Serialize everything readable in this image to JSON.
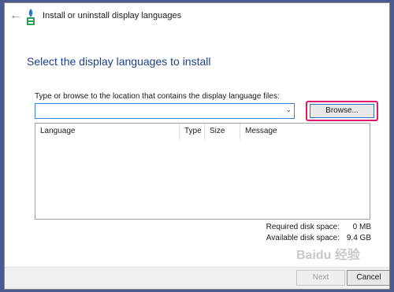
{
  "window": {
    "title": "Install or uninstall display languages",
    "back_icon": "arrow-left-icon",
    "app_icon": "language-icon"
  },
  "main": {
    "heading": "Select the display languages to install",
    "instruction": "Type or browse to the location that contains the display language files:",
    "path_value": "",
    "browse_label": "Browse...",
    "table": {
      "columns": [
        "Language",
        "Type",
        "Size",
        "Message"
      ],
      "rows": []
    },
    "disk": {
      "required_label": "Required disk space:",
      "required_value": "0 MB",
      "available_label": "Available disk space:",
      "available_value": "9.4 GB"
    }
  },
  "footer": {
    "next_label": "Next",
    "cancel_label": "Cancel"
  },
  "watermark": "Baidu 经验",
  "colors": {
    "accent": "#1e3f8a",
    "highlight": "#e0176d"
  }
}
